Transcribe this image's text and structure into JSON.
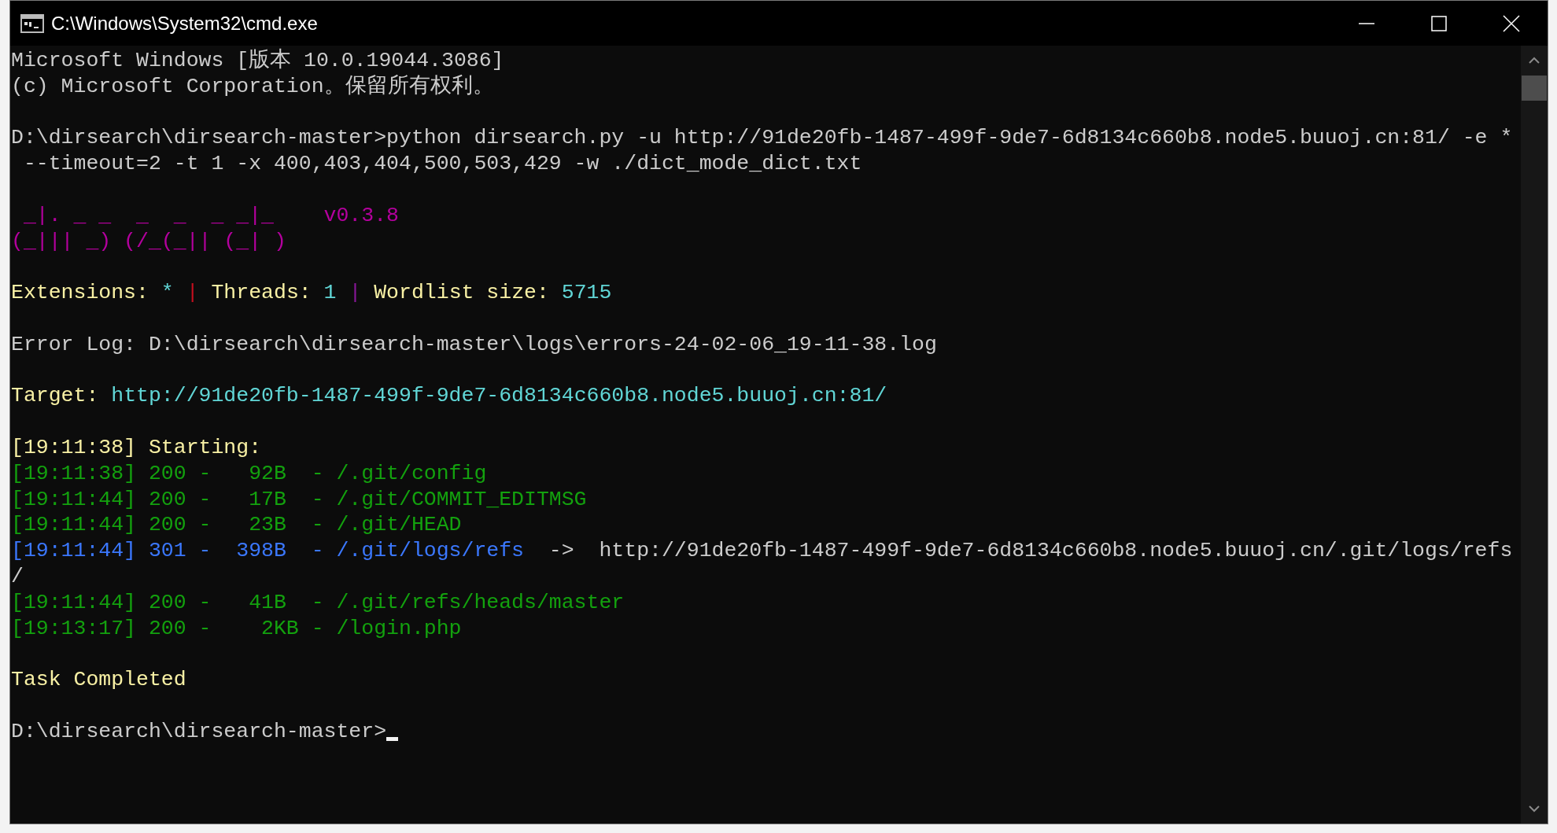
{
  "window": {
    "title": "C:\\Windows\\System32\\cmd.exe"
  },
  "console": {
    "blocks": [
      {
        "lines": [
          {
            "segments": [
              {
                "text": "Microsoft Windows [版本 10.0.19044.3086]",
                "color": "#cccccc"
              }
            ]
          },
          {
            "segments": [
              {
                "text": "(c) Microsoft Corporation。保留所有权利。",
                "color": "#cccccc"
              }
            ]
          }
        ]
      },
      {
        "lines": [
          {
            "segments": [
              {
                "text": "D:\\dirsearch\\dirsearch-master>python dirsearch.py -u http://91de20fb-1487-499f-9de7-6d8134c660b8.node5.buuoj.cn:81/ -e *",
                "color": "#cccccc"
              }
            ]
          },
          {
            "segments": [
              {
                "text": " --timeout=2 -t 1 -x 400,403,404,500,503,429 -w ./dict_mode_dict.txt",
                "color": "#cccccc"
              }
            ]
          }
        ]
      },
      {
        "lines": [
          {
            "segments": [
              {
                "text": " _|. _ _  _  _  _ _|_    v0.3.8",
                "color": "#b4009e"
              }
            ]
          },
          {
            "segments": [
              {
                "text": "(_||| _) (/_(_|| (_| )",
                "color": "#b4009e"
              }
            ]
          }
        ]
      },
      {
        "lines": [
          {
            "segments": [
              {
                "text": "Extensions: ",
                "color": "#f9f1a5"
              },
              {
                "text": "*",
                "color": "#61d6d6"
              },
              {
                "text": " | ",
                "color": "#c50f1f"
              },
              {
                "text": "Threads: ",
                "color": "#f9f1a5"
              },
              {
                "text": "1",
                "color": "#61d6d6"
              },
              {
                "text": " | ",
                "color": "#881798"
              },
              {
                "text": "Wordlist size: ",
                "color": "#f9f1a5"
              },
              {
                "text": "5715",
                "color": "#61d6d6"
              }
            ]
          }
        ]
      },
      {
        "lines": [
          {
            "segments": [
              {
                "text": "Error Log: D:\\dirsearch\\dirsearch-master\\logs\\errors-24-02-06_19-11-38.log",
                "color": "#cccccc"
              }
            ]
          }
        ]
      },
      {
        "lines": [
          {
            "segments": [
              {
                "text": "Target: ",
                "color": "#f9f1a5"
              },
              {
                "text": "http://91de20fb-1487-499f-9de7-6d8134c660b8.node5.buuoj.cn:81/",
                "color": "#61d6d6"
              }
            ]
          }
        ]
      },
      {
        "lines": [
          {
            "segments": [
              {
                "text": "[19:11:38] Starting:",
                "color": "#f9f1a5"
              }
            ]
          },
          {
            "segments": [
              {
                "text": "[19:11:38] 200 -   92B  - /.git/config",
                "color": "#13a10e"
              }
            ]
          },
          {
            "segments": [
              {
                "text": "[19:11:44] 200 -   17B  - /.git/COMMIT_EDITMSG",
                "color": "#13a10e"
              }
            ]
          },
          {
            "segments": [
              {
                "text": "[19:11:44] 200 -   23B  - /.git/HEAD",
                "color": "#13a10e"
              }
            ]
          },
          {
            "segments": [
              {
                "text": "[19:11:44] 301 -  398B  - /.git/logs/refs",
                "color": "#3b78ff"
              },
              {
                "text": "  ->  http://91de20fb-1487-499f-9de7-6d8134c660b8.node5.buuoj.cn/.git/logs/refs",
                "color": "#cccccc"
              }
            ]
          },
          {
            "segments": [
              {
                "text": "/",
                "color": "#cccccc"
              }
            ]
          },
          {
            "segments": [
              {
                "text": "[19:11:44] 200 -   41B  - /.git/refs/heads/master",
                "color": "#13a10e"
              }
            ]
          },
          {
            "segments": [
              {
                "text": "[19:13:17] 200 -    2KB - /login.php",
                "color": "#13a10e"
              }
            ]
          }
        ]
      },
      {
        "lines": [
          {
            "segments": [
              {
                "text": "Task Completed",
                "color": "#f9f1a5"
              }
            ]
          }
        ]
      },
      {
        "lines": [
          {
            "segments": [
              {
                "text": "D:\\dirsearch\\dirsearch-master>",
                "color": "#cccccc"
              }
            ],
            "cursor": true
          }
        ]
      }
    ]
  }
}
